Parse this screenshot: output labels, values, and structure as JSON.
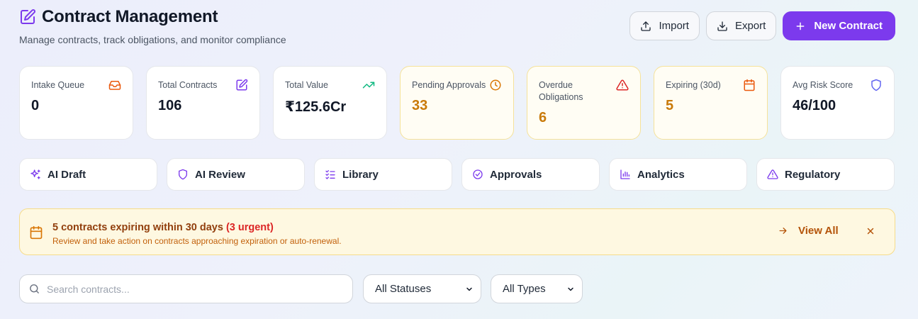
{
  "header": {
    "title": "Contract Management",
    "subtitle": "Manage contracts, track obligations, and monitor compliance",
    "actions": {
      "import_label": "Import",
      "export_label": "Export",
      "new_label": "New Contract"
    }
  },
  "colors": {
    "accent": "#7c3aed",
    "warning": "#c97a0a",
    "danger": "#dc2626",
    "success": "#10b981"
  },
  "stats": [
    {
      "label": "Intake Queue",
      "value": "0",
      "icon": "inbox-icon"
    },
    {
      "label": "Total Contracts",
      "value": "106",
      "icon": "edit-document-icon"
    },
    {
      "label": "Total Value",
      "value": "₹125.6Cr",
      "icon": "trending-up-icon"
    },
    {
      "label": "Pending Approvals",
      "value": "33",
      "icon": "clock-icon"
    },
    {
      "label": "Overdue Obligations",
      "value": "6",
      "icon": "alert-triangle-icon"
    },
    {
      "label": "Expiring (30d)",
      "value": "5",
      "icon": "calendar-icon"
    },
    {
      "label": "Avg Risk Score",
      "value": "46/100",
      "icon": "shield-icon"
    }
  ],
  "tools": [
    {
      "label": "AI Draft",
      "icon": "sparkles-icon"
    },
    {
      "label": "AI Review",
      "icon": "shield-icon"
    },
    {
      "label": "Library",
      "icon": "list-checks-icon"
    },
    {
      "label": "Approvals",
      "icon": "check-circle-icon"
    },
    {
      "label": "Analytics",
      "icon": "bar-chart-icon"
    },
    {
      "label": "Regulatory",
      "icon": "alert-triangle-icon"
    }
  ],
  "banner": {
    "title": "5 contracts expiring within 30 days",
    "urgent": "(3 urgent)",
    "description": "Review and take action on contracts approaching expiration or auto-renewal.",
    "action_label": "View All"
  },
  "filters": {
    "search_placeholder": "Search contracts...",
    "status_value": "All Statuses",
    "type_value": "All Types"
  }
}
